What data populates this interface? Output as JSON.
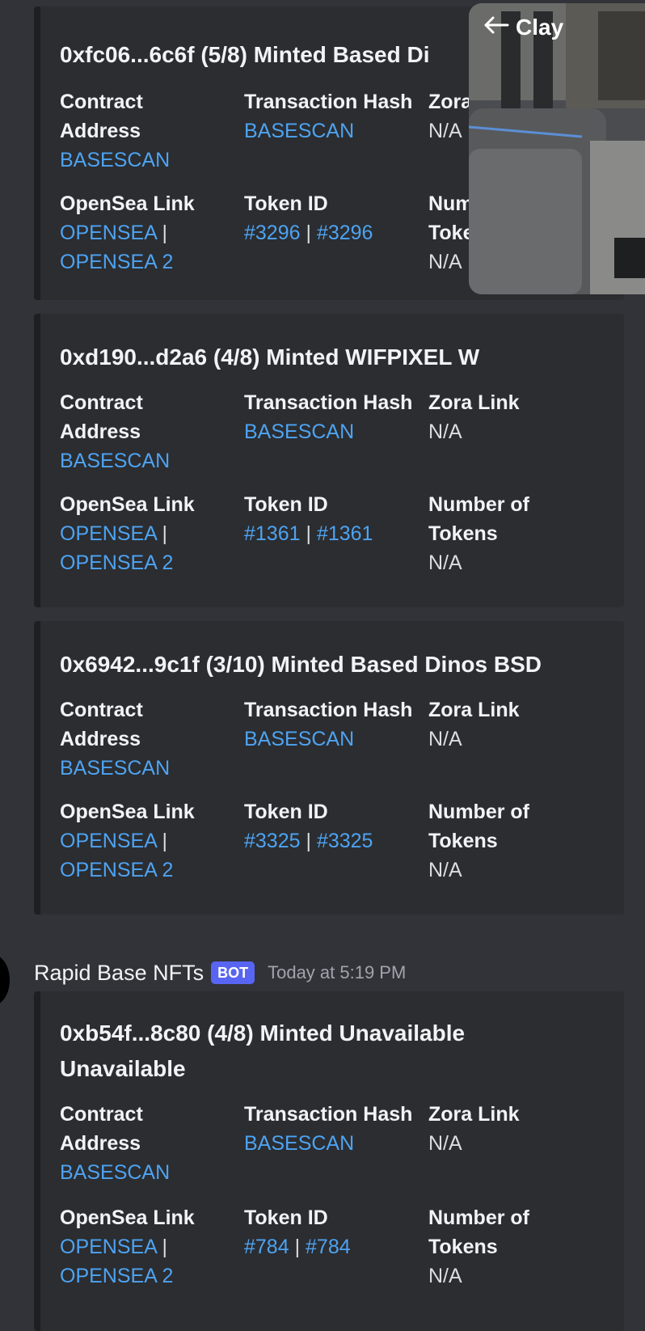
{
  "field_names": {
    "contract": [
      "Contract",
      "Address"
    ],
    "tx": "Transaction Hash",
    "zora": "Zora Link",
    "opensea": "OpenSea Link",
    "token": "Token ID",
    "count": [
      "Number of",
      "Tokens"
    ]
  },
  "embeds": [
    {
      "title": "0xfc06...6c6f (5/8) Minted Based Di",
      "contract_link": "BASESCAN",
      "tx_link": "BASESCAN",
      "zora_value": "N/A",
      "zora_name_visible": "Zora",
      "opensea_links": [
        "OPENSEA",
        "OPENSEA 2"
      ],
      "token_ids": [
        "#3296",
        "#3296"
      ],
      "count_name_visible": [
        "Num",
        "Toke"
      ],
      "count_value": "N/A"
    },
    {
      "title": "0xd190...d2a6 (4/8) Minted WIFPIXEL W",
      "contract_link": "BASESCAN",
      "tx_link": "BASESCAN",
      "zora_value": "N/A",
      "opensea_links": [
        "OPENSEA",
        "OPENSEA 2"
      ],
      "token_ids": [
        "#1361",
        "#1361"
      ],
      "count_value": "N/A"
    },
    {
      "title": "0x6942...9c1f (3/10) Minted Based Dinos BSD",
      "contract_link": "BASESCAN",
      "tx_link": "BASESCAN",
      "zora_value": "N/A",
      "opensea_links": [
        "OPENSEA",
        "OPENSEA 2"
      ],
      "token_ids": [
        "#3325",
        "#3325"
      ],
      "count_value": "N/A"
    },
    {
      "title": [
        "0xb54f...8c80 (4/8) Minted Unavailable",
        "Unavailable"
      ],
      "contract_link": "BASESCAN",
      "tx_link": "BASESCAN",
      "zora_value": "N/A",
      "opensea_links": [
        "OPENSEA",
        "OPENSEA 2"
      ],
      "token_ids": [
        "#784",
        "#784"
      ],
      "count_value": "N/A"
    }
  ],
  "separator": "|",
  "message": {
    "author": "Rapid Base NFTs",
    "bot_tag": "BOT",
    "timestamp": "Today at 5:19 PM"
  },
  "pip": {
    "back_icon": "arrow-left-icon",
    "label": "Clay"
  },
  "colors": {
    "background": "#313338",
    "embed_background": "#2b2d31",
    "link": "#4ea3f1",
    "bot_tag": "#5865f2"
  }
}
